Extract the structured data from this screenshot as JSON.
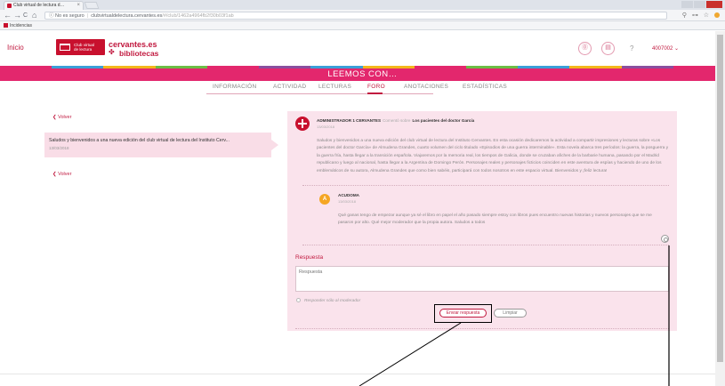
{
  "browser": {
    "tab_title": "Club virtual de lectura d…",
    "tab_close": "×",
    "nav_back": "←",
    "nav_forward": "→",
    "nav_reload": "C",
    "nav_home": "⌂",
    "url_security": "ⓘ No es seguro",
    "url_host": "clubvirtualdelectura.cervantes.es",
    "url_path": "/#/club/1462a4964fb2f30b03f1ab",
    "right_icons": "⚲ ⊶ ☆",
    "bookmark": "Incidencias"
  },
  "header": {
    "inicio": "Inicio",
    "logo_line1": "Club virtual",
    "logo_line2": "de lectura",
    "brand_line1": "cervantes.es",
    "brand_line2": "bibliotecas",
    "icon1": "⓪",
    "icon2": "▤",
    "help": "?",
    "user": "4007002 ⌄"
  },
  "colors": {
    "rainbow": [
      "#e3276d",
      "#3a9fd8",
      "#f3b71b",
      "#6cbd45",
      "#e3276d",
      "#8a4f9e",
      "#3a9fd8",
      "#f3b71b",
      "#e3276d",
      "#6cbd45",
      "#3a9fd8",
      "#f3b71b",
      "#8a4f9e",
      "#e3276d"
    ]
  },
  "banner": {
    "title": "LEEMOS CON…"
  },
  "tabs": {
    "t1": "INFORMACIÓN",
    "t2": "ACTIVIDAD",
    "t3": "LECTURAS",
    "t4": "FORO",
    "t5": "ANOTACIONES",
    "t6": "ESTADÍSTICAS"
  },
  "sidebar": {
    "back": "❮ Volver",
    "topic_title": "Saludos y bienvenidos a una nueva edición del club virtual de lectura del Instituto Cerv...",
    "topic_date": "13/03/2018",
    "back2": "❮ Volver"
  },
  "post": {
    "author": "ADMINISTRADOR 1 CERVANTES",
    "comment_on": "Comentó sobre",
    "topic": "Los pacientes del doctor García",
    "date": "13/03/2018",
    "body": "Saludos y bienvenidos a una nueva edición del club virtual de lectura del Instituto Cervantes. En esta ocasión dedicaremos la actividad a compartir impresiones y lecturas sobre «Los pacientes del doctor García» de Almudena Grandes, cuarto volumen del ciclo titulado «Episodios de una guerra interminable». Esta novela abarca tres períodos: la guerra, la posguerra y la guerra fría, hasta llegar a la transición española. Viajaremos por la memoria real, los tiempos de Galicia, donde se cruzaban afiches de la barbarie humana, pasando por el Madrid republicano y luego al nacional, hasta llegar a la Argentina de Domingo Perón. Personajes reales y personajes ficticios coinciden en este aventura de espías y haciendo de uno de los emblemáticos de su autora, Almudena Grandes que como bien sabéis, participará con todos nosotros en este espacio virtual. Bienvenidos y ¡feliz lectura!"
  },
  "reply": {
    "avatar": "A",
    "name": "ACUDOMA",
    "date": "13/03/2018",
    "body": "Qué ganas tengo de empezar aunque ya sé el libro en papel el año pasado siempre estoy con libros pues encuentro nuevas historias y nuevos personajes que se me pasaron por alto. Qué mejor moderador que la propia autora. Saludos a todos"
  },
  "form": {
    "label": "Respuesta",
    "placeholder": "Respuesta",
    "moderator_only": "Responder sólo al moderador",
    "send": "Enviar respuesta",
    "clear": "Limpiar"
  }
}
